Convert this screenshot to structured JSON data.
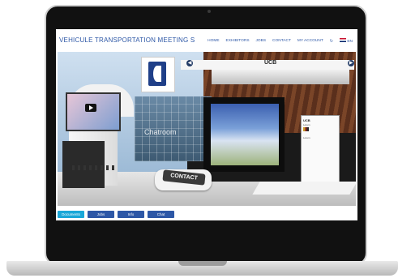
{
  "site": {
    "title": "VEHICULE TRANSPORTATION MEETING S",
    "nav": [
      "HOME",
      "EXHIBITORS",
      "JOBS",
      "CONTACT",
      "MY ACCOUNT"
    ],
    "language": "EN"
  },
  "stand": {
    "name": "UCB",
    "chatroom_label": "Chatroom",
    "contact_label": "CONTACT",
    "poster_title": "UCB",
    "poster_subtitle": "Lorem",
    "poster_line": "Lorem"
  },
  "tabs": [
    {
      "label": "Documents",
      "active": true
    },
    {
      "label": "Jobs",
      "active": false
    },
    {
      "label": "Info",
      "active": false
    },
    {
      "label": "Chat",
      "active": false
    }
  ],
  "colors": {
    "accent": "#2d57a6",
    "active_tab": "#1aa7d8"
  },
  "icons": {
    "refresh": "refresh-icon",
    "prev": "arrow-left-icon",
    "next": "arrow-right-icon",
    "play": "play-icon",
    "flag": "uk-flag-icon"
  }
}
